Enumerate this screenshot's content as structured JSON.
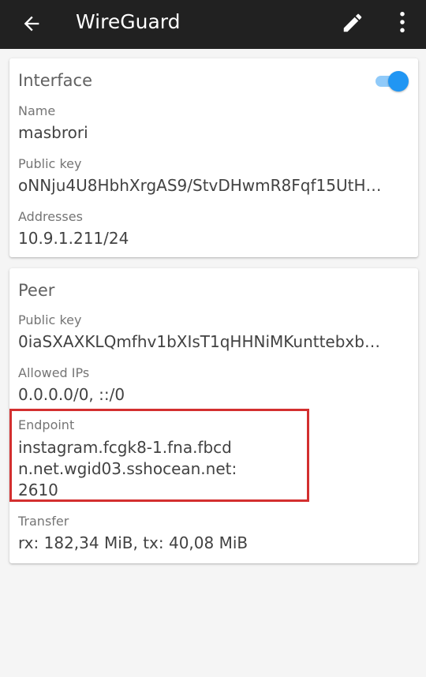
{
  "appbar": {
    "title": "WireGuard",
    "back_icon": "arrow-back-icon",
    "edit_icon": "pencil-icon",
    "more_icon": "more-vert-icon"
  },
  "interface": {
    "title": "Interface",
    "toggle_on": true,
    "name_label": "Name",
    "name_value": "masbrori",
    "public_key_label": "Public key",
    "public_key_value": "oNNju4U8HbhXrgAS9/StvDHwmR8Fqf15UtH…",
    "addresses_label": "Addresses",
    "addresses_value": "10.9.1.211/24"
  },
  "peer": {
    "title": "Peer",
    "public_key_label": "Public key",
    "public_key_value": "0iaSXAXKLQmfhv1bXIsT1qHHNiMKunttebxb…",
    "allowed_ips_label": "Allowed IPs",
    "allowed_ips_value": "0.0.0.0/0, ::/0",
    "endpoint_label": "Endpoint",
    "endpoint_line1": "instagram.fcgk8-1.fna.fbcd",
    "endpoint_line2": "n.net.wgid03.sshocean.net:",
    "endpoint_line3": "2610",
    "transfer_label": "Transfer",
    "transfer_value": "rx: 182,34 MiB, tx: 40,08 MiB"
  },
  "colors": {
    "appbar": "#212121",
    "accent": "#2196f3",
    "highlight": "#d32f2f"
  }
}
